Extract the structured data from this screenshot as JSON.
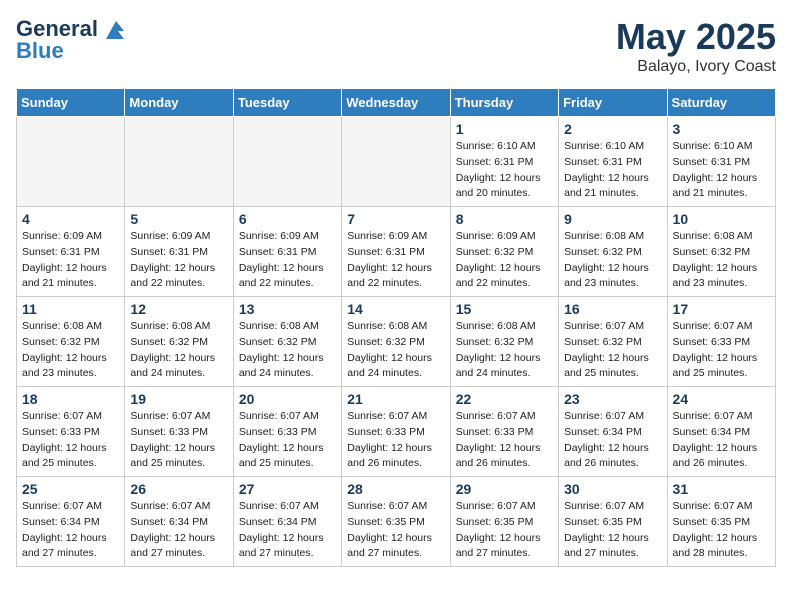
{
  "header": {
    "logo_line1": "General",
    "logo_line2": "Blue",
    "month": "May 2025",
    "location": "Balayo, Ivory Coast"
  },
  "weekdays": [
    "Sunday",
    "Monday",
    "Tuesday",
    "Wednesday",
    "Thursday",
    "Friday",
    "Saturday"
  ],
  "weeks": [
    [
      {
        "day": "",
        "info": ""
      },
      {
        "day": "",
        "info": ""
      },
      {
        "day": "",
        "info": ""
      },
      {
        "day": "",
        "info": ""
      },
      {
        "day": "1",
        "info": "Sunrise: 6:10 AM\nSunset: 6:31 PM\nDaylight: 12 hours\nand 20 minutes."
      },
      {
        "day": "2",
        "info": "Sunrise: 6:10 AM\nSunset: 6:31 PM\nDaylight: 12 hours\nand 21 minutes."
      },
      {
        "day": "3",
        "info": "Sunrise: 6:10 AM\nSunset: 6:31 PM\nDaylight: 12 hours\nand 21 minutes."
      }
    ],
    [
      {
        "day": "4",
        "info": "Sunrise: 6:09 AM\nSunset: 6:31 PM\nDaylight: 12 hours\nand 21 minutes."
      },
      {
        "day": "5",
        "info": "Sunrise: 6:09 AM\nSunset: 6:31 PM\nDaylight: 12 hours\nand 22 minutes."
      },
      {
        "day": "6",
        "info": "Sunrise: 6:09 AM\nSunset: 6:31 PM\nDaylight: 12 hours\nand 22 minutes."
      },
      {
        "day": "7",
        "info": "Sunrise: 6:09 AM\nSunset: 6:31 PM\nDaylight: 12 hours\nand 22 minutes."
      },
      {
        "day": "8",
        "info": "Sunrise: 6:09 AM\nSunset: 6:32 PM\nDaylight: 12 hours\nand 22 minutes."
      },
      {
        "day": "9",
        "info": "Sunrise: 6:08 AM\nSunset: 6:32 PM\nDaylight: 12 hours\nand 23 minutes."
      },
      {
        "day": "10",
        "info": "Sunrise: 6:08 AM\nSunset: 6:32 PM\nDaylight: 12 hours\nand 23 minutes."
      }
    ],
    [
      {
        "day": "11",
        "info": "Sunrise: 6:08 AM\nSunset: 6:32 PM\nDaylight: 12 hours\nand 23 minutes."
      },
      {
        "day": "12",
        "info": "Sunrise: 6:08 AM\nSunset: 6:32 PM\nDaylight: 12 hours\nand 24 minutes."
      },
      {
        "day": "13",
        "info": "Sunrise: 6:08 AM\nSunset: 6:32 PM\nDaylight: 12 hours\nand 24 minutes."
      },
      {
        "day": "14",
        "info": "Sunrise: 6:08 AM\nSunset: 6:32 PM\nDaylight: 12 hours\nand 24 minutes."
      },
      {
        "day": "15",
        "info": "Sunrise: 6:08 AM\nSunset: 6:32 PM\nDaylight: 12 hours\nand 24 minutes."
      },
      {
        "day": "16",
        "info": "Sunrise: 6:07 AM\nSunset: 6:32 PM\nDaylight: 12 hours\nand 25 minutes."
      },
      {
        "day": "17",
        "info": "Sunrise: 6:07 AM\nSunset: 6:33 PM\nDaylight: 12 hours\nand 25 minutes."
      }
    ],
    [
      {
        "day": "18",
        "info": "Sunrise: 6:07 AM\nSunset: 6:33 PM\nDaylight: 12 hours\nand 25 minutes."
      },
      {
        "day": "19",
        "info": "Sunrise: 6:07 AM\nSunset: 6:33 PM\nDaylight: 12 hours\nand 25 minutes."
      },
      {
        "day": "20",
        "info": "Sunrise: 6:07 AM\nSunset: 6:33 PM\nDaylight: 12 hours\nand 25 minutes."
      },
      {
        "day": "21",
        "info": "Sunrise: 6:07 AM\nSunset: 6:33 PM\nDaylight: 12 hours\nand 26 minutes."
      },
      {
        "day": "22",
        "info": "Sunrise: 6:07 AM\nSunset: 6:33 PM\nDaylight: 12 hours\nand 26 minutes."
      },
      {
        "day": "23",
        "info": "Sunrise: 6:07 AM\nSunset: 6:34 PM\nDaylight: 12 hours\nand 26 minutes."
      },
      {
        "day": "24",
        "info": "Sunrise: 6:07 AM\nSunset: 6:34 PM\nDaylight: 12 hours\nand 26 minutes."
      }
    ],
    [
      {
        "day": "25",
        "info": "Sunrise: 6:07 AM\nSunset: 6:34 PM\nDaylight: 12 hours\nand 27 minutes."
      },
      {
        "day": "26",
        "info": "Sunrise: 6:07 AM\nSunset: 6:34 PM\nDaylight: 12 hours\nand 27 minutes."
      },
      {
        "day": "27",
        "info": "Sunrise: 6:07 AM\nSunset: 6:34 PM\nDaylight: 12 hours\nand 27 minutes."
      },
      {
        "day": "28",
        "info": "Sunrise: 6:07 AM\nSunset: 6:35 PM\nDaylight: 12 hours\nand 27 minutes."
      },
      {
        "day": "29",
        "info": "Sunrise: 6:07 AM\nSunset: 6:35 PM\nDaylight: 12 hours\nand 27 minutes."
      },
      {
        "day": "30",
        "info": "Sunrise: 6:07 AM\nSunset: 6:35 PM\nDaylight: 12 hours\nand 27 minutes."
      },
      {
        "day": "31",
        "info": "Sunrise: 6:07 AM\nSunset: 6:35 PM\nDaylight: 12 hours\nand 28 minutes."
      }
    ]
  ]
}
